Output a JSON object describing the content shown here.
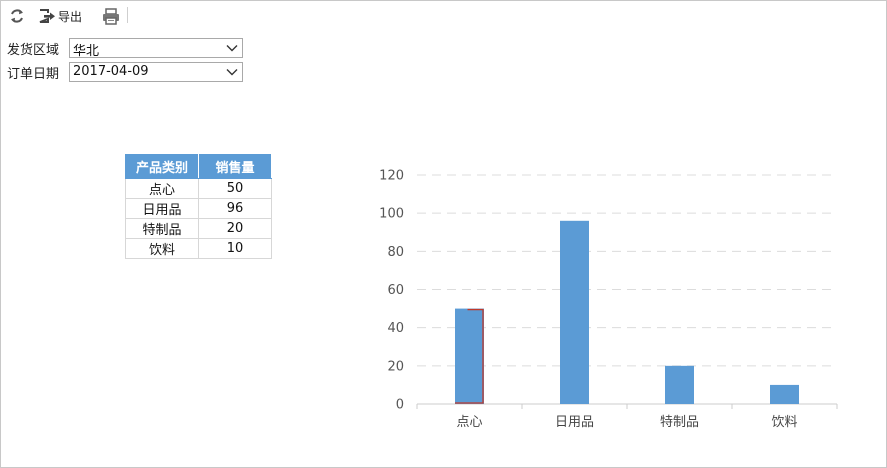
{
  "toolbar": {
    "refresh_icon": "refresh-icon",
    "export_icon": "export-icon",
    "export_label": "导出",
    "print_icon": "printer-icon"
  },
  "params": {
    "region": {
      "label": "发货区域",
      "value": "华北"
    },
    "order_date": {
      "label": "订单日期",
      "value": "2017-04-09"
    }
  },
  "table": {
    "headers": [
      "产品类别",
      "销售量"
    ],
    "rows": [
      [
        "点心",
        "50"
      ],
      [
        "日用品",
        "96"
      ],
      [
        "特制品",
        "20"
      ],
      [
        "饮料",
        "10"
      ]
    ]
  },
  "chart_data": {
    "type": "bar",
    "categories": [
      "点心",
      "日用品",
      "特制品",
      "饮料"
    ],
    "values": [
      50,
      96,
      20,
      10
    ],
    "title": "",
    "xlabel": "",
    "ylabel": "",
    "ylim": [
      0,
      120
    ],
    "yticks": [
      0,
      20,
      40,
      60,
      80,
      100,
      120
    ],
    "grid": true,
    "bar_color": "#5b9bd5"
  },
  "colors": {
    "accent": "#5b9bd5",
    "selected_outline": "#c0392b"
  }
}
